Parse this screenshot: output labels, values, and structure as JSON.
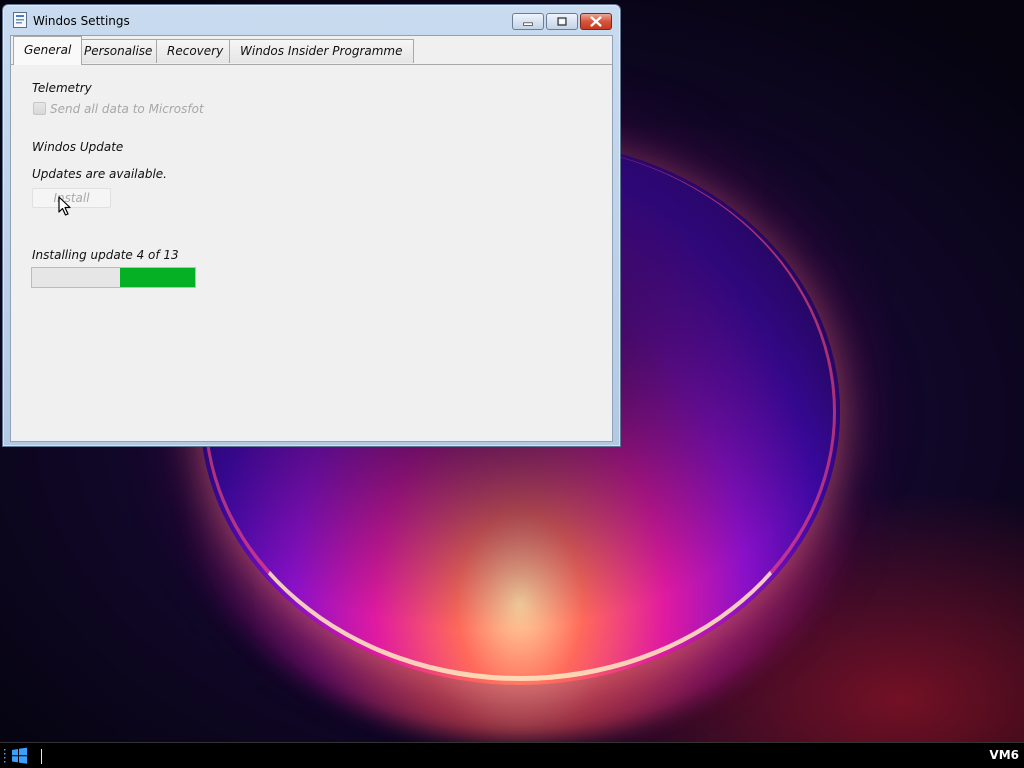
{
  "window": {
    "title": "Windos Settings"
  },
  "tabs": [
    {
      "label": "General",
      "active": true
    },
    {
      "label": "Personalise",
      "active": false
    },
    {
      "label": "Recovery",
      "active": false
    },
    {
      "label": "Windos Insider Programme",
      "active": false
    }
  ],
  "telemetry": {
    "heading": "Telemetry",
    "checkbox_label": "Send all data to Microsfot",
    "checked": false,
    "enabled": false
  },
  "update": {
    "heading": "Windos Update",
    "status": "Updates are available.",
    "install_button": "Install",
    "install_enabled": false,
    "progress_text": "Installing update 4 of 13",
    "progress": {
      "empty_fraction": 0.54,
      "filled_fraction": 0.46,
      "fill_color": "#06b025"
    }
  },
  "taskbar": {
    "start_icon": "windows-logo-icon",
    "tray_label": "VM6"
  },
  "colors": {
    "progress_fill": "#06b025",
    "taskbar": "#000000"
  }
}
